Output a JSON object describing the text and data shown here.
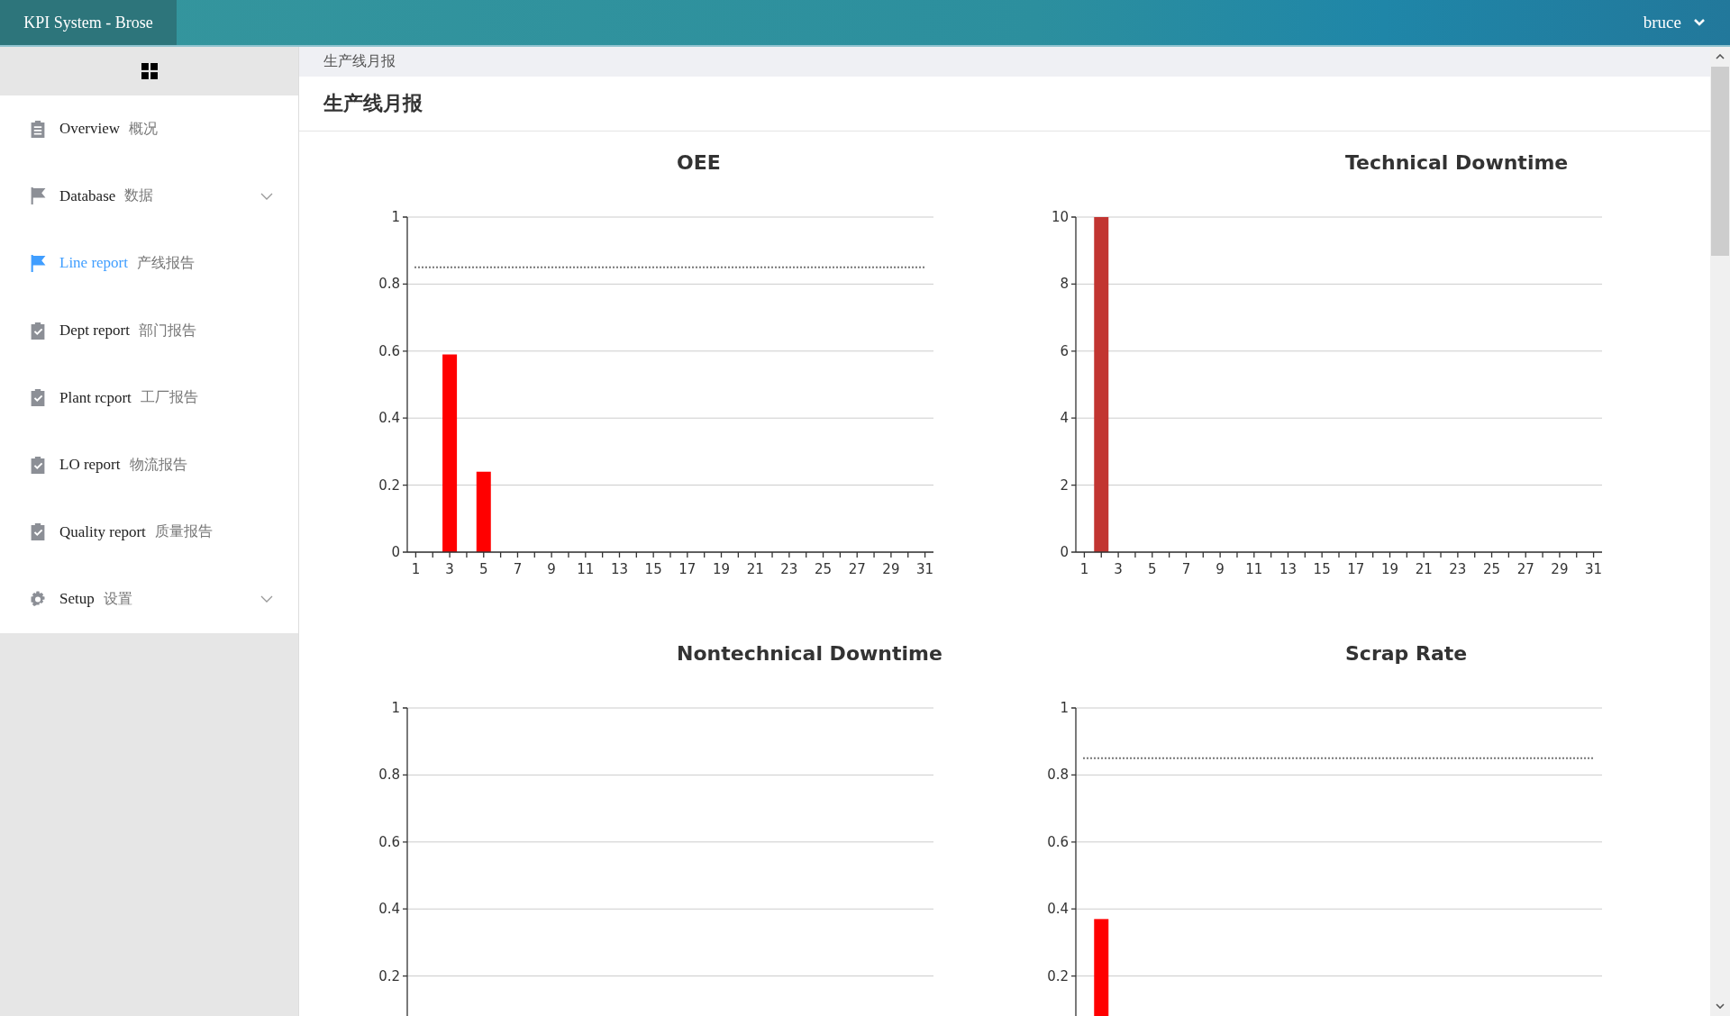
{
  "header": {
    "app_title": "KPI System - Brose",
    "user": "bruce"
  },
  "sidebar": {
    "items": [
      {
        "kind": "document",
        "label": "Overview",
        "label_cn": "概况",
        "selected": false
      },
      {
        "kind": "flag",
        "label": "Database",
        "label_cn": "数据",
        "selected": false,
        "expanded": false
      },
      {
        "kind": "flag",
        "label": "Line report",
        "label_cn": "产线报告",
        "selected": true
      },
      {
        "kind": "checklist",
        "label": "Dept report",
        "label_cn": "部门报告",
        "selected": false
      },
      {
        "kind": "checklist",
        "label": "Plant rcport",
        "label_cn": "工厂报告",
        "selected": false
      },
      {
        "kind": "checklist",
        "label": "LO report",
        "label_cn": "物流报告",
        "selected": false
      },
      {
        "kind": "checklist",
        "label": "Quality report",
        "label_cn": "质量报告",
        "selected": false
      },
      {
        "kind": "gear",
        "label": "Setup",
        "label_cn": "设置",
        "selected": false,
        "expanded": false
      }
    ]
  },
  "breadcrumb": "生产线月报",
  "page_title": "生产线月报",
  "charts": [
    {
      "chart_data": {
        "type": "bar",
        "title": "OEE",
        "x": [
          3,
          5
        ],
        "series": [
          {
            "color": "#ff0000",
            "values": [
              0.59,
              0.24
            ]
          }
        ],
        "xlim": [
          0.5,
          31.5
        ],
        "ylim": [
          0,
          1
        ],
        "xticks": [
          1,
          3,
          5,
          7,
          9,
          11,
          13,
          15,
          17,
          19,
          21,
          23,
          25,
          27,
          29,
          31
        ],
        "yticks": [
          0,
          0.2,
          0.4,
          0.6,
          0.8,
          1
        ],
        "grid": true,
        "ref_lines": [
          {
            "axis": "y",
            "value": 0.85
          }
        ]
      }
    },
    {
      "chart_data": {
        "type": "bar",
        "title": "Technical Downtime",
        "x": [
          2
        ],
        "series": [
          {
            "color": "#c23531",
            "values": [
              10
            ]
          }
        ],
        "xlim": [
          0.5,
          31.5
        ],
        "ylim": [
          0,
          10
        ],
        "xticks": [
          1,
          3,
          5,
          7,
          9,
          11,
          13,
          15,
          17,
          19,
          21,
          23,
          25,
          27,
          29,
          31
        ],
        "yticks": [
          0,
          2,
          4,
          6,
          8,
          10
        ],
        "grid": true
      }
    },
    {
      "chart_data": {
        "type": "bar",
        "title": "Nontechnical Downtime",
        "categories": [
          null,
          null,
          null,
          null,
          null,
          null,
          null,
          null,
          null,
          null,
          null,
          null,
          null,
          null,
          null,
          null,
          null,
          null,
          null,
          null,
          null,
          null,
          null,
          null,
          null,
          null,
          null,
          null,
          null,
          null,
          null
        ],
        "series": [
          {
            "values": [
              null,
              null,
              null,
              null,
              null,
              null,
              null,
              null,
              null,
              null,
              null,
              null,
              null,
              null,
              null,
              null,
              null,
              null,
              null,
              null,
              null,
              null,
              null,
              null,
              null,
              null,
              null,
              null,
              null,
              null,
              null
            ]
          }
        ],
        "ylim": [
          0,
          1
        ],
        "yticks": [
          0.2,
          0.4,
          0.6,
          0.8,
          1
        ],
        "grid": true
      }
    },
    {
      "chart_data": {
        "type": "bar",
        "title": "Scrap Rate",
        "x": [
          2
        ],
        "series": [
          {
            "color": "#ff0000",
            "values": [
              0.37
            ]
          }
        ],
        "xlim": [
          0.5,
          31.5
        ],
        "ylim": [
          0,
          1
        ],
        "yticks": [
          0.2,
          0.4,
          0.6,
          0.8,
          1
        ],
        "grid": true,
        "ref_lines": [
          {
            "axis": "y",
            "value": 0.85
          }
        ]
      }
    }
  ]
}
